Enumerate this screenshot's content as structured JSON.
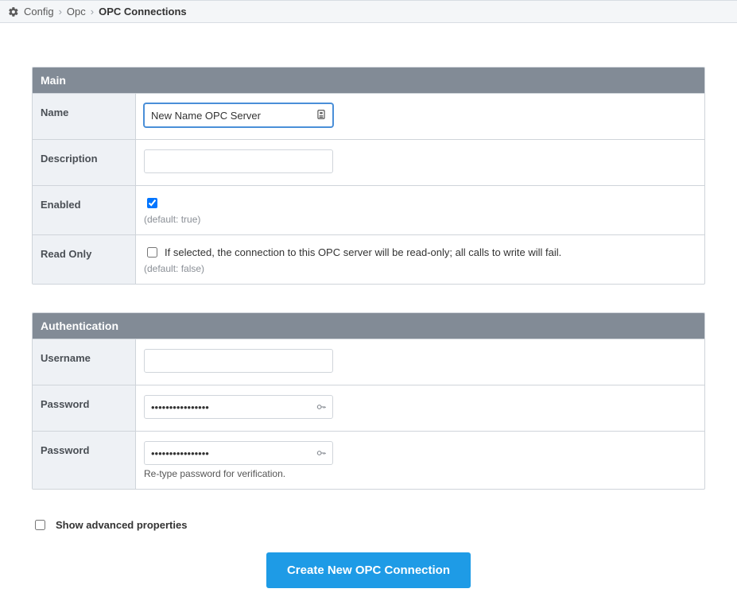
{
  "breadcrumb": {
    "items": [
      "Config",
      "Opc",
      "OPC Connections"
    ]
  },
  "main_section": {
    "title": "Main",
    "name": {
      "label": "Name",
      "value": "New Name OPC Server"
    },
    "description": {
      "label": "Description",
      "value": ""
    },
    "enabled": {
      "label": "Enabled",
      "checked": true,
      "helper": "(default: true)"
    },
    "read_only": {
      "label": "Read Only",
      "checked": false,
      "text": "If selected, the connection to this OPC server will be read-only; all calls to write will fail.",
      "helper": "(default: false)"
    }
  },
  "auth_section": {
    "title": "Authentication",
    "username": {
      "label": "Username",
      "value": ""
    },
    "password": {
      "label": "Password",
      "value": "••••••••••••••••"
    },
    "password_confirm": {
      "label": "Password",
      "value": "••••••••••••••••",
      "helper": "Re-type password for verification."
    }
  },
  "advanced": {
    "label": "Show advanced properties",
    "checked": false
  },
  "submit": {
    "label": "Create New OPC Connection"
  }
}
